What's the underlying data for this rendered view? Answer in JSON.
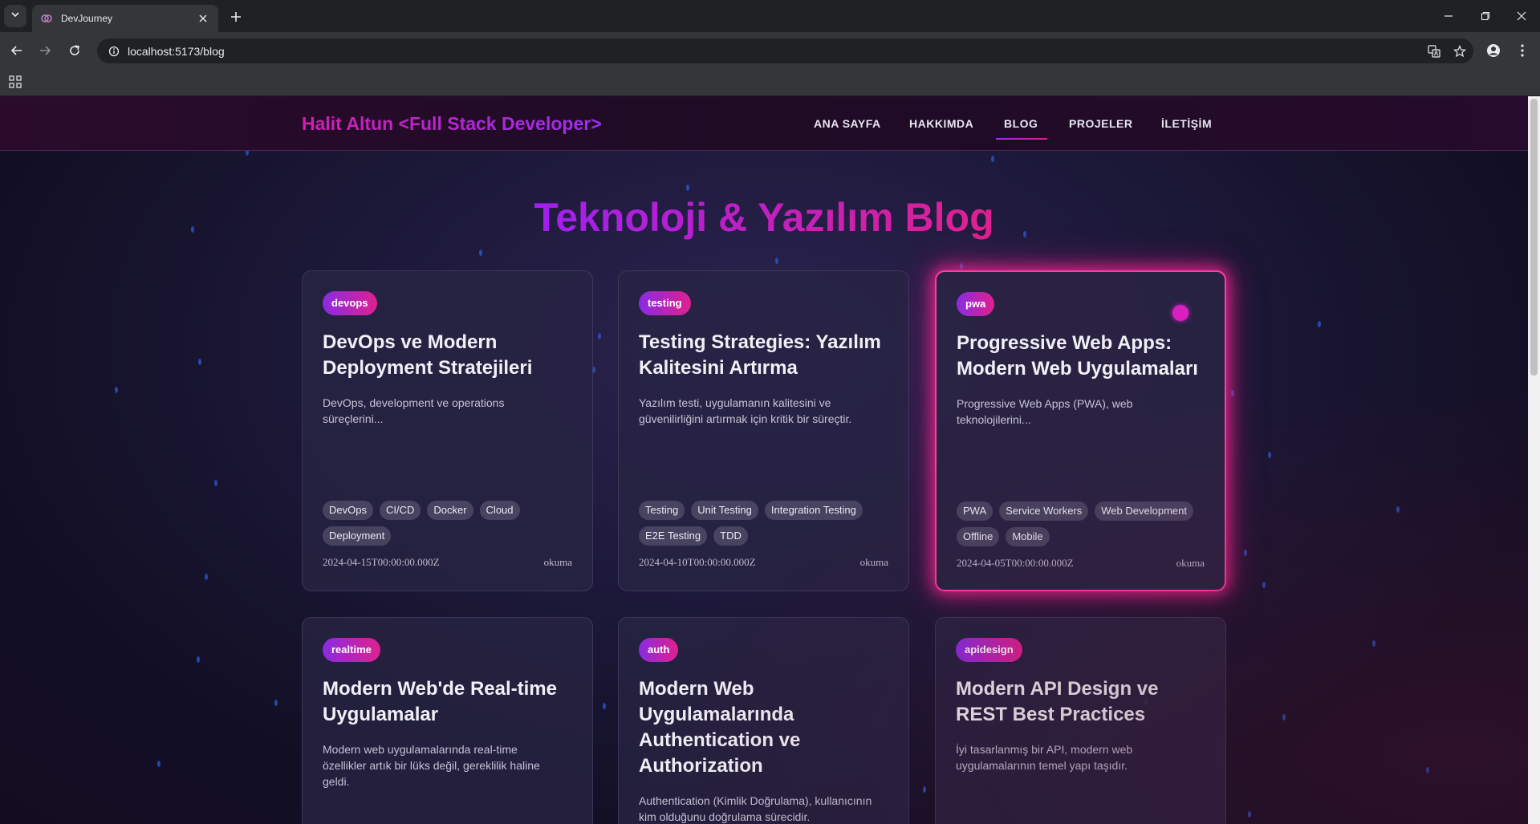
{
  "browser": {
    "tab_title": "DevJourney",
    "url": "localhost:5173/blog"
  },
  "site": {
    "brand": "Halit Altun <Full Stack Developer>",
    "nav": [
      "ANA SAYFA",
      "HAKKIMDA",
      "BLOG",
      "PROJELER",
      "İLETİŞİM"
    ],
    "active_nav": "BLOG",
    "page_title": "Teknoloji & Yazılım Blog"
  },
  "colors": {
    "accent_purple": "#9b2ef0",
    "accent_pink": "#e0208f",
    "card_glow": "#ff3ca8"
  },
  "posts": [
    {
      "category": "devops",
      "title": "DevOps ve Modern Deployment Stratejileri",
      "excerpt": "DevOps, development ve operations süreçlerini...",
      "tags": [
        "DevOps",
        "CI/CD",
        "Docker",
        "Cloud",
        "Deployment"
      ],
      "date": "2024-04-15T00:00:00.000Z",
      "read": "okuma"
    },
    {
      "category": "testing",
      "title": "Testing Strategies: Yazılım Kalitesini Artırma",
      "excerpt": "Yazılım testi, uygulamanın kalitesini ve güvenilirliğini artırmak için kritik bir süreçtir.",
      "tags": [
        "Testing",
        "Unit Testing",
        "Integration Testing",
        "E2E Testing",
        "TDD"
      ],
      "date": "2024-04-10T00:00:00.000Z",
      "read": "okuma"
    },
    {
      "category": "pwa",
      "title": "Progressive Web Apps: Modern Web Uygulamaları",
      "excerpt": "Progressive Web Apps (PWA), web teknolojilerini...",
      "tags": [
        "PWA",
        "Service Workers",
        "Web Development",
        "Offline",
        "Mobile"
      ],
      "date": "2024-04-05T00:00:00.000Z",
      "read": "okuma"
    },
    {
      "category": "realtime",
      "title": "Modern Web'de Real-time Uygulamalar",
      "excerpt": "Modern web uygulamalarında real-time özellikler artık bir lüks değil, gereklilik haline geldi."
    },
    {
      "category": "auth",
      "title": "Modern Web Uygulamalarında Authentication ve Authorization",
      "excerpt": "Authentication (Kimlik Doğrulama), kullanıcının kim olduğunu doğrulama sürecidir."
    },
    {
      "category": "apidesign",
      "title": "Modern API Design ve REST Best Practices",
      "excerpt": "İyi tasarlanmış bir API, modern web uygulamalarının temel yapı taşıdır."
    }
  ]
}
